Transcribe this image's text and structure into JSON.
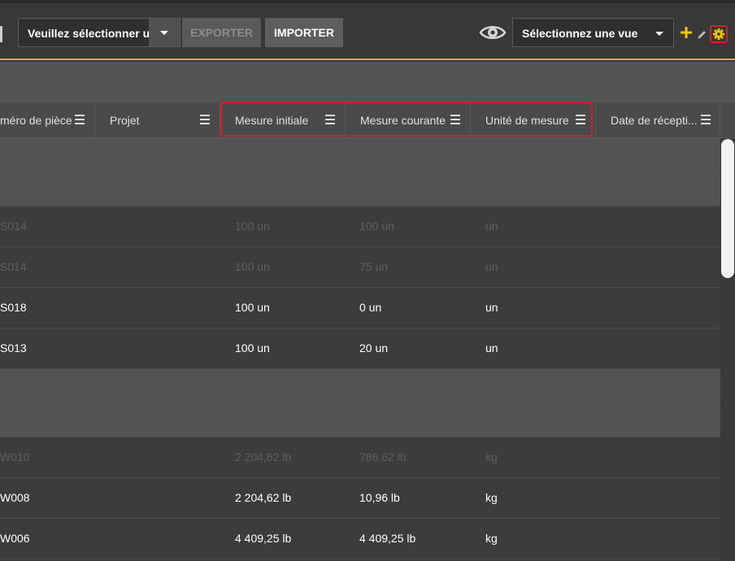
{
  "toolbar": {
    "select_placeholder": "Veuillez sélectionner un",
    "export_label": "EXPORTER",
    "import_label": "IMPORTER",
    "view_select": "Sélectionnez une vue",
    "icons": [
      "eye-icon",
      "plus-icon",
      "pencil-icon",
      "gear-icon"
    ],
    "accent_color": "#d8b21a",
    "highlight_color": "#d0202a"
  },
  "columns": [
    "méro de pièce",
    "Projet",
    "Mesure initiale",
    "Mesure courante",
    "Unité de mesure",
    "Date de récepti..."
  ],
  "rows": [
    {
      "kind": "group"
    },
    {
      "kind": "group"
    },
    {
      "kind": "data",
      "dim": true,
      "part": "S014",
      "initial": "100 un",
      "current": "100 un",
      "unit": "un"
    },
    {
      "kind": "data",
      "dim": true,
      "part": "S014",
      "initial": "100 un",
      "current": "75 un",
      "unit": "un"
    },
    {
      "kind": "data",
      "dim": false,
      "part": "S018",
      "initial": "100 un",
      "current": "0 un",
      "unit": "un"
    },
    {
      "kind": "data",
      "dim": false,
      "part": "S013",
      "initial": "100 un",
      "current": "20 un",
      "unit": "un"
    },
    {
      "kind": "group"
    },
    {
      "kind": "group"
    },
    {
      "kind": "data",
      "dim": true,
      "part": "W010",
      "initial": "2 204,62 lb",
      "current": "786,62 lb",
      "unit": "kg"
    },
    {
      "kind": "data",
      "dim": false,
      "part": "W008",
      "initial": "2 204,62 lb",
      "current": "10,96 lb",
      "unit": "kg"
    },
    {
      "kind": "data",
      "dim": false,
      "part": "W006",
      "initial": "4 409,25 lb",
      "current": "4 409,25 lb",
      "unit": "kg"
    }
  ]
}
